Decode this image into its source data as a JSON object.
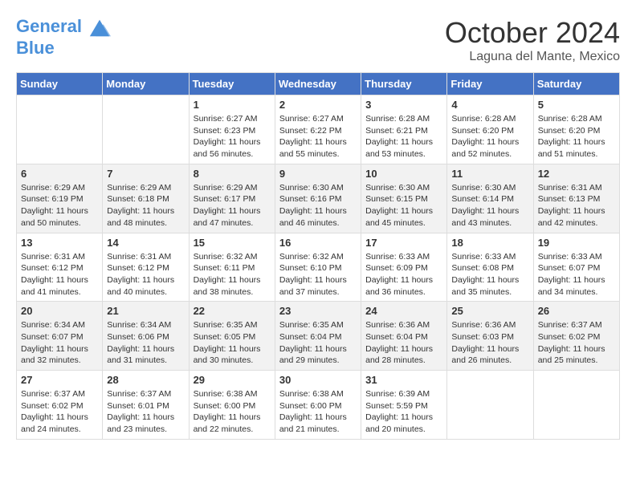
{
  "header": {
    "logo_line1": "General",
    "logo_line2": "Blue",
    "month": "October 2024",
    "location": "Laguna del Mante, Mexico"
  },
  "days_of_week": [
    "Sunday",
    "Monday",
    "Tuesday",
    "Wednesday",
    "Thursday",
    "Friday",
    "Saturday"
  ],
  "weeks": [
    [
      {
        "num": "",
        "info": ""
      },
      {
        "num": "",
        "info": ""
      },
      {
        "num": "1",
        "info": "Sunrise: 6:27 AM\nSunset: 6:23 PM\nDaylight: 11 hours and 56 minutes."
      },
      {
        "num": "2",
        "info": "Sunrise: 6:27 AM\nSunset: 6:22 PM\nDaylight: 11 hours and 55 minutes."
      },
      {
        "num": "3",
        "info": "Sunrise: 6:28 AM\nSunset: 6:21 PM\nDaylight: 11 hours and 53 minutes."
      },
      {
        "num": "4",
        "info": "Sunrise: 6:28 AM\nSunset: 6:20 PM\nDaylight: 11 hours and 52 minutes."
      },
      {
        "num": "5",
        "info": "Sunrise: 6:28 AM\nSunset: 6:20 PM\nDaylight: 11 hours and 51 minutes."
      }
    ],
    [
      {
        "num": "6",
        "info": "Sunrise: 6:29 AM\nSunset: 6:19 PM\nDaylight: 11 hours and 50 minutes."
      },
      {
        "num": "7",
        "info": "Sunrise: 6:29 AM\nSunset: 6:18 PM\nDaylight: 11 hours and 48 minutes."
      },
      {
        "num": "8",
        "info": "Sunrise: 6:29 AM\nSunset: 6:17 PM\nDaylight: 11 hours and 47 minutes."
      },
      {
        "num": "9",
        "info": "Sunrise: 6:30 AM\nSunset: 6:16 PM\nDaylight: 11 hours and 46 minutes."
      },
      {
        "num": "10",
        "info": "Sunrise: 6:30 AM\nSunset: 6:15 PM\nDaylight: 11 hours and 45 minutes."
      },
      {
        "num": "11",
        "info": "Sunrise: 6:30 AM\nSunset: 6:14 PM\nDaylight: 11 hours and 43 minutes."
      },
      {
        "num": "12",
        "info": "Sunrise: 6:31 AM\nSunset: 6:13 PM\nDaylight: 11 hours and 42 minutes."
      }
    ],
    [
      {
        "num": "13",
        "info": "Sunrise: 6:31 AM\nSunset: 6:12 PM\nDaylight: 11 hours and 41 minutes."
      },
      {
        "num": "14",
        "info": "Sunrise: 6:31 AM\nSunset: 6:12 PM\nDaylight: 11 hours and 40 minutes."
      },
      {
        "num": "15",
        "info": "Sunrise: 6:32 AM\nSunset: 6:11 PM\nDaylight: 11 hours and 38 minutes."
      },
      {
        "num": "16",
        "info": "Sunrise: 6:32 AM\nSunset: 6:10 PM\nDaylight: 11 hours and 37 minutes."
      },
      {
        "num": "17",
        "info": "Sunrise: 6:33 AM\nSunset: 6:09 PM\nDaylight: 11 hours and 36 minutes."
      },
      {
        "num": "18",
        "info": "Sunrise: 6:33 AM\nSunset: 6:08 PM\nDaylight: 11 hours and 35 minutes."
      },
      {
        "num": "19",
        "info": "Sunrise: 6:33 AM\nSunset: 6:07 PM\nDaylight: 11 hours and 34 minutes."
      }
    ],
    [
      {
        "num": "20",
        "info": "Sunrise: 6:34 AM\nSunset: 6:07 PM\nDaylight: 11 hours and 32 minutes."
      },
      {
        "num": "21",
        "info": "Sunrise: 6:34 AM\nSunset: 6:06 PM\nDaylight: 11 hours and 31 minutes."
      },
      {
        "num": "22",
        "info": "Sunrise: 6:35 AM\nSunset: 6:05 PM\nDaylight: 11 hours and 30 minutes."
      },
      {
        "num": "23",
        "info": "Sunrise: 6:35 AM\nSunset: 6:04 PM\nDaylight: 11 hours and 29 minutes."
      },
      {
        "num": "24",
        "info": "Sunrise: 6:36 AM\nSunset: 6:04 PM\nDaylight: 11 hours and 28 minutes."
      },
      {
        "num": "25",
        "info": "Sunrise: 6:36 AM\nSunset: 6:03 PM\nDaylight: 11 hours and 26 minutes."
      },
      {
        "num": "26",
        "info": "Sunrise: 6:37 AM\nSunset: 6:02 PM\nDaylight: 11 hours and 25 minutes."
      }
    ],
    [
      {
        "num": "27",
        "info": "Sunrise: 6:37 AM\nSunset: 6:02 PM\nDaylight: 11 hours and 24 minutes."
      },
      {
        "num": "28",
        "info": "Sunrise: 6:37 AM\nSunset: 6:01 PM\nDaylight: 11 hours and 23 minutes."
      },
      {
        "num": "29",
        "info": "Sunrise: 6:38 AM\nSunset: 6:00 PM\nDaylight: 11 hours and 22 minutes."
      },
      {
        "num": "30",
        "info": "Sunrise: 6:38 AM\nSunset: 6:00 PM\nDaylight: 11 hours and 21 minutes."
      },
      {
        "num": "31",
        "info": "Sunrise: 6:39 AM\nSunset: 5:59 PM\nDaylight: 11 hours and 20 minutes."
      },
      {
        "num": "",
        "info": ""
      },
      {
        "num": "",
        "info": ""
      }
    ]
  ]
}
